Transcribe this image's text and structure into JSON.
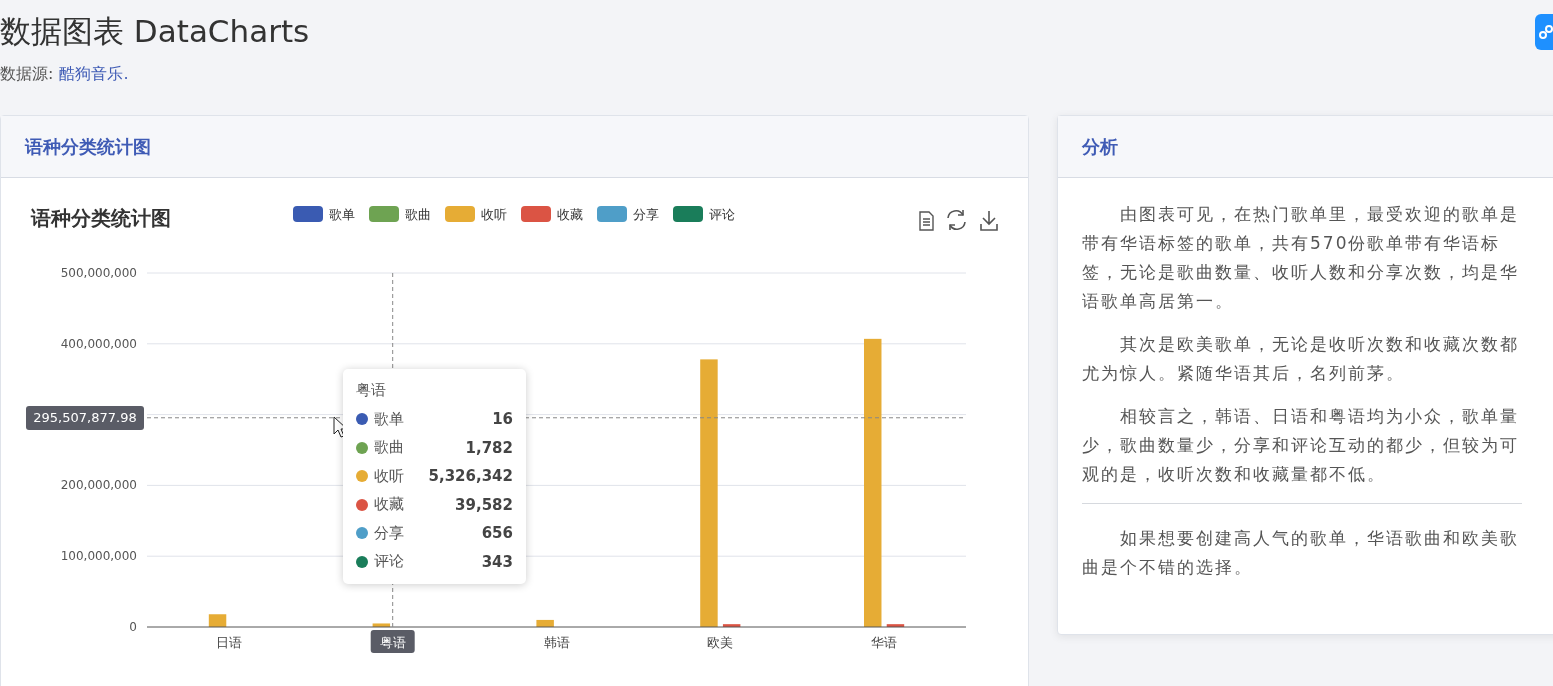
{
  "page": {
    "title": "数据图表 DataCharts",
    "source_label": "数据源:",
    "source_link": "酷狗音乐."
  },
  "chart_card": {
    "header": "语种分类统计图",
    "chart": {
      "tooltip": {
        "title": "粤语",
        "rows": [
          {
            "label": "歌单",
            "value": "16"
          },
          {
            "label": "歌曲",
            "value": "1,782"
          },
          {
            "label": "收听",
            "value": "5,326,342"
          },
          {
            "label": "收藏",
            "value": "39,582"
          },
          {
            "label": "分享",
            "value": "656"
          },
          {
            "label": "评论",
            "value": "343"
          }
        ]
      },
      "chart_data": {
        "type": "bar",
        "title": "语种分类统计图",
        "categories": [
          "日语",
          "粤语",
          "韩语",
          "欧美",
          "华语"
        ],
        "series": [
          {
            "name": "歌单",
            "color": "#3a5bb2",
            "values": [
              0,
              0,
              0,
              0,
              0
            ]
          },
          {
            "name": "歌曲",
            "color": "#6ea352",
            "values": [
              0,
              0,
              0,
              0,
              0
            ]
          },
          {
            "name": "收听",
            "color": "#e6ac35",
            "values": [
              18000000,
              5000000,
              10000000,
              378000000,
              407000000
            ]
          },
          {
            "name": "收藏",
            "color": "#db5444",
            "values": [
              0,
              0,
              0,
              4000000,
              4000000
            ]
          },
          {
            "name": "分享",
            "color": "#4f9ec8",
            "values": [
              0,
              0,
              0,
              0,
              0
            ]
          },
          {
            "name": "评论",
            "color": "#1a7d5a",
            "values": [
              0,
              0,
              0,
              0,
              0
            ]
          }
        ],
        "legend": true,
        "ref_lines": [
          {
            "axis": "x",
            "value": "粤语"
          },
          {
            "axis": "y",
            "value": 295507877.98,
            "label": "295,507,877.98"
          }
        ],
        "grid": true,
        "ylim": [
          0,
          500000000
        ],
        "yticks": [
          {
            "value": 0,
            "label": "0"
          },
          {
            "value": 100000000,
            "label": "100,000,000"
          },
          {
            "value": 200000000,
            "label": "200,000,000"
          },
          {
            "value": 400000000,
            "label": "400,000,000"
          },
          {
            "value": 500000000,
            "label": "500,000,000"
          }
        ]
      }
    }
  },
  "analysis_card": {
    "header": "分析",
    "paragraphs": [
      "由图表可见，在热门歌单里，最受欢迎的歌单是带有华语标签的歌单，共有570份歌单带有华语标签，无论是歌曲数量、收听人数和分享次数，均是华语歌单高居第一。",
      "其次是欧美歌单，无论是收听次数和收藏次数都尤为惊人。紧随华语其后，名列前茅。",
      "相较言之，韩语、日语和粤语均为小众，歌单量少，歌曲数量少，分享和评论互动的都少，但较为可观的是，收听次数和收藏量都不低。"
    ],
    "conclusion": "如果想要创建高人气的歌单，华语歌曲和欧美歌曲是个不错的选择。"
  }
}
